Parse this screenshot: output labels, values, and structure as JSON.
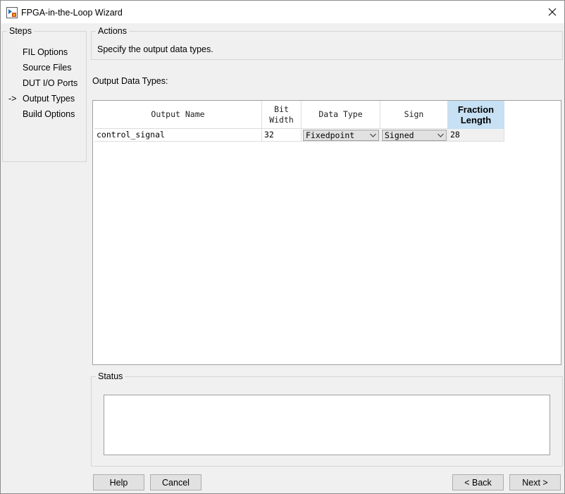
{
  "window": {
    "title": "FPGA-in-the-Loop Wizard",
    "app_icon": "fpga-app-icon",
    "close_icon": "close-icon"
  },
  "steps": {
    "legend": "Steps",
    "current_marker": "->",
    "items": [
      {
        "label": "FIL Options",
        "current": false
      },
      {
        "label": "Source Files",
        "current": false
      },
      {
        "label": "DUT I/O Ports",
        "current": false
      },
      {
        "label": "Output Types",
        "current": true
      },
      {
        "label": "Build Options",
        "current": false
      }
    ]
  },
  "actions": {
    "legend": "Actions",
    "text": "Specify the output data types."
  },
  "output_types": {
    "label": "Output Data Types:",
    "columns": {
      "output_name": "Output Name",
      "bit_width_line1": "Bit",
      "bit_width_line2": "Width",
      "data_type": "Data Type",
      "sign": "Sign",
      "fraction_length_line1": "Fraction",
      "fraction_length_line2": "Length"
    },
    "rows": [
      {
        "output_name": "control_signal",
        "bit_width": "32",
        "data_type": "Fixedpoint",
        "sign": "Signed",
        "fraction_length": "28"
      }
    ]
  },
  "status": {
    "legend": "Status",
    "text": ""
  },
  "buttons": {
    "help": "Help",
    "cancel": "Cancel",
    "back": "< Back",
    "next": "Next >"
  },
  "colors": {
    "window_bg": "#f0f0f0",
    "selected_header_bg": "#c7e0f4",
    "button_bg": "#e1e1e1"
  }
}
